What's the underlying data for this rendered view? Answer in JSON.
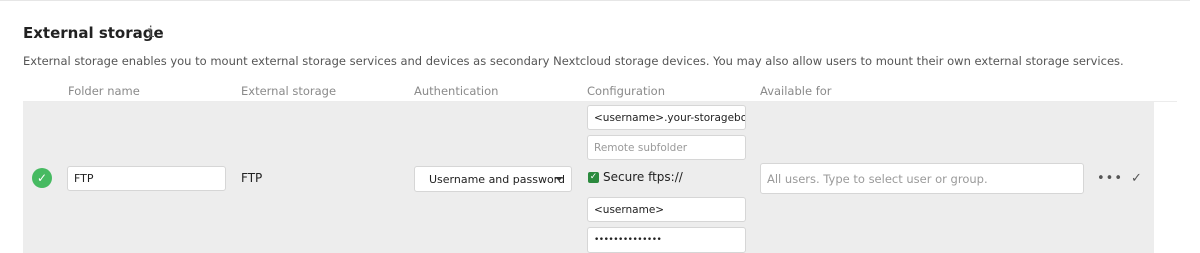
{
  "section": {
    "title": "External storage",
    "info_icon": "i",
    "description": "External storage enables you to mount external storage services and devices as secondary Nextcloud storage devices. You may also allow users to mount their own external storage services."
  },
  "columns": {
    "folder_name": "Folder name",
    "external_storage": "External storage",
    "authentication": "Authentication",
    "configuration": "Configuration",
    "available_for": "Available for"
  },
  "mount": {
    "status_icon": "check-circle-icon",
    "status_glyph": "✓",
    "status_color": "#46ba61",
    "folder_name": "FTP",
    "backend": "FTP",
    "auth_selected": "Username and password",
    "config": {
      "host_value": "<username>.your-storagebox.de",
      "subfolder_placeholder": "Remote subfolder",
      "secure_checked": true,
      "secure_label": "Secure ftps://",
      "user_value": "<username>",
      "password_mask": "••••••••••••••"
    },
    "applicable_placeholder": "All users. Type to select user or group.",
    "more_glyph": "•••",
    "confirm_glyph": "✓"
  }
}
